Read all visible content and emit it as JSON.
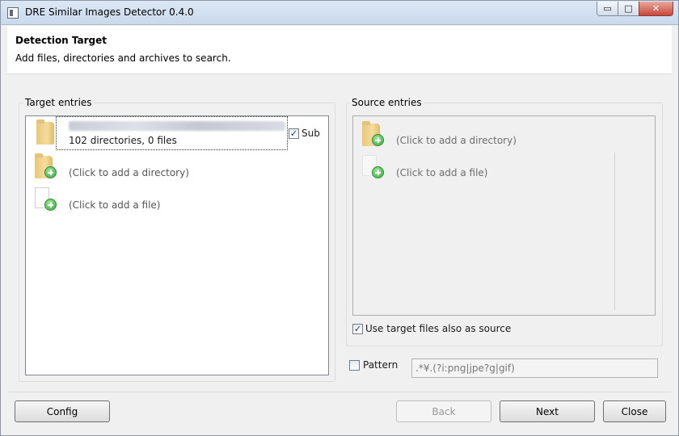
{
  "window": {
    "title": "DRE Similar Images Detector 0.4.0",
    "minimize_glyph": "▭",
    "maximize_glyph": "□",
    "close_glyph": "✕"
  },
  "header": {
    "title": "Detection Target",
    "subtitle": "Add files, directories and archives to search."
  },
  "target": {
    "label": "Target entries",
    "entries": [
      {
        "summary": "102 directories, 0 files",
        "sub_label": "Sub",
        "sub_checked": true,
        "icon": "folder-icon"
      }
    ],
    "add_directory": "(Click to add a directory)",
    "add_file": "(Click to add a file)"
  },
  "source": {
    "label": "Source entries",
    "add_directory": "(Click to add a directory)",
    "add_file": "(Click to add a file)",
    "use_target_label": "Use target files also as source",
    "use_target_checked": true
  },
  "pattern": {
    "label": "Pattern",
    "checked": false,
    "value": ".*¥.(?i:png|jpe?g|gif)"
  },
  "buttons": {
    "config": "Config",
    "back": "Back",
    "next": "Next",
    "close": "Close"
  },
  "checkmark": "✓",
  "colors": {
    "titlebar": "#c9d9ec",
    "close_button": "#c7473a",
    "plus_green": "#3cad3c"
  }
}
